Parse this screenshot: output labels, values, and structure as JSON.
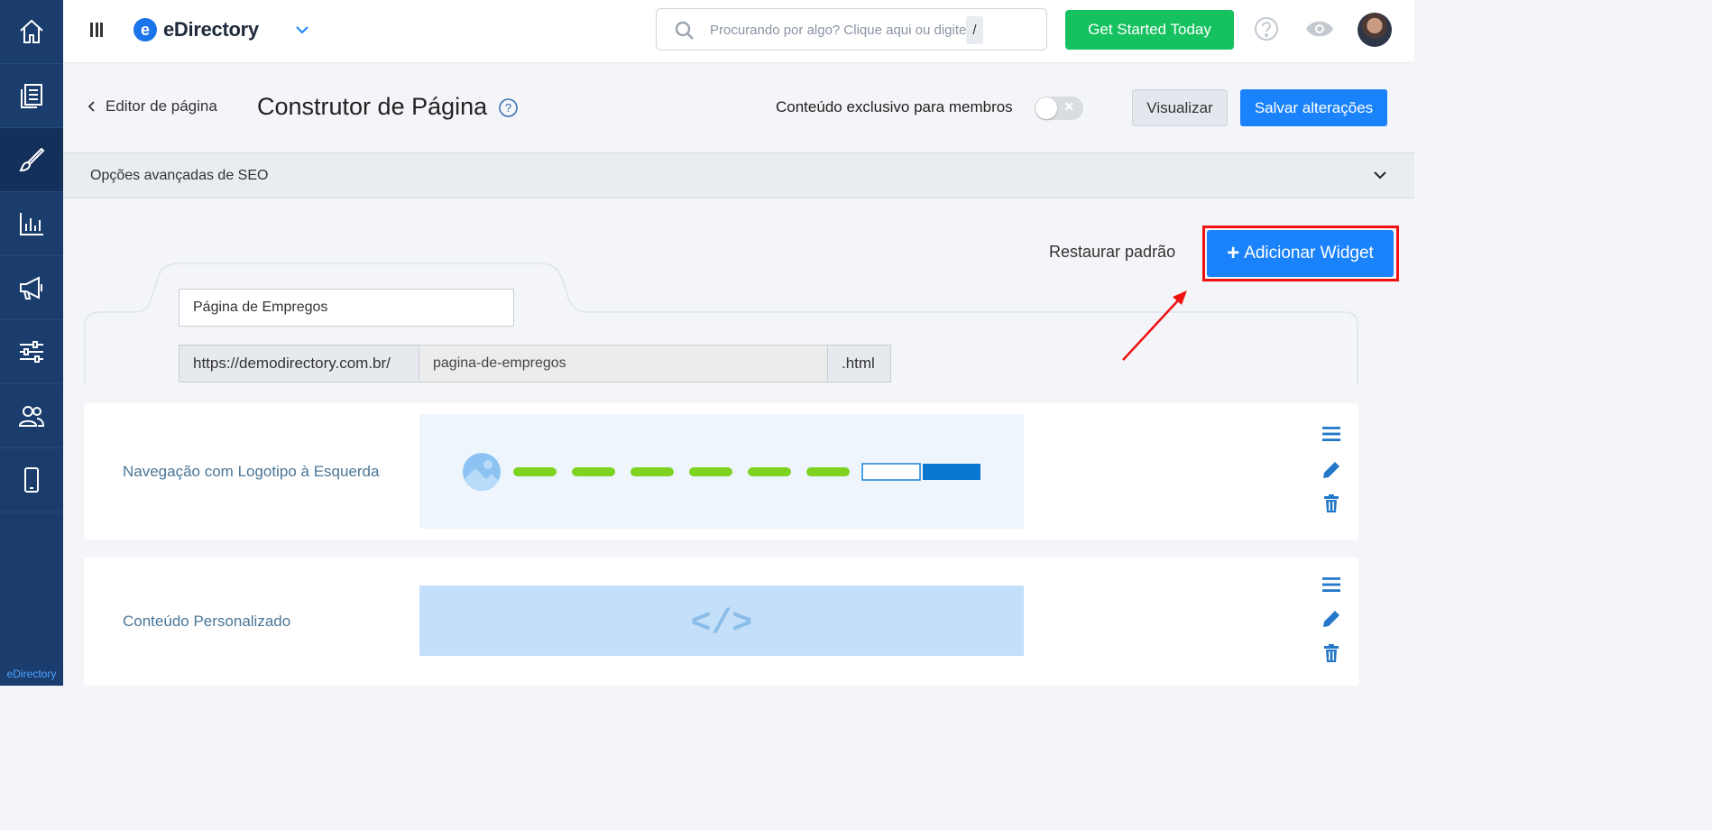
{
  "sidebar": {
    "items": [
      {
        "icon": "home-icon"
      },
      {
        "icon": "pages-icon"
      },
      {
        "icon": "brush-icon"
      },
      {
        "icon": "chart-icon"
      },
      {
        "icon": "megaphone-icon"
      },
      {
        "icon": "sliders-icon"
      },
      {
        "icon": "users-icon"
      },
      {
        "icon": "mobile-icon"
      }
    ],
    "brand_footer": "eDirectory"
  },
  "topbar": {
    "brand_name": "eDirectory",
    "search_placeholder": "Procurando por algo? Clique aqui ou digite",
    "search_shortcut": "/",
    "cta_label": "Get Started Today"
  },
  "header": {
    "back_label": "Editor de página",
    "title": "Construtor de Página",
    "members_label": "Conteúdo exclusivo para membros",
    "members_toggle": "off",
    "preview_label": "Visualizar",
    "save_label": "Salvar alterações"
  },
  "seo": {
    "label": "Opções avançadas de SEO"
  },
  "actions": {
    "restore_label": "Restaurar padrão",
    "add_widget_label": "Adicionar Widget",
    "add_widget_plus": "+"
  },
  "page_settings": {
    "page_name": "Página de Empregos",
    "url_prefix": "https://demodirectory.com.br/",
    "url_slug": "pagina-de-empregos",
    "url_suffix": ".html"
  },
  "widgets": [
    {
      "label": "Navegação com Logotipo à Esquerda"
    },
    {
      "label": "Conteúdo Personalizado",
      "preview_glyph": "</>"
    }
  ],
  "colors": {
    "sidebar": "#1a3d6d",
    "primary": "#1a82fb",
    "cta_green": "#16c160",
    "highlight_red": "#f01010",
    "nav_green": "#7ed321"
  }
}
